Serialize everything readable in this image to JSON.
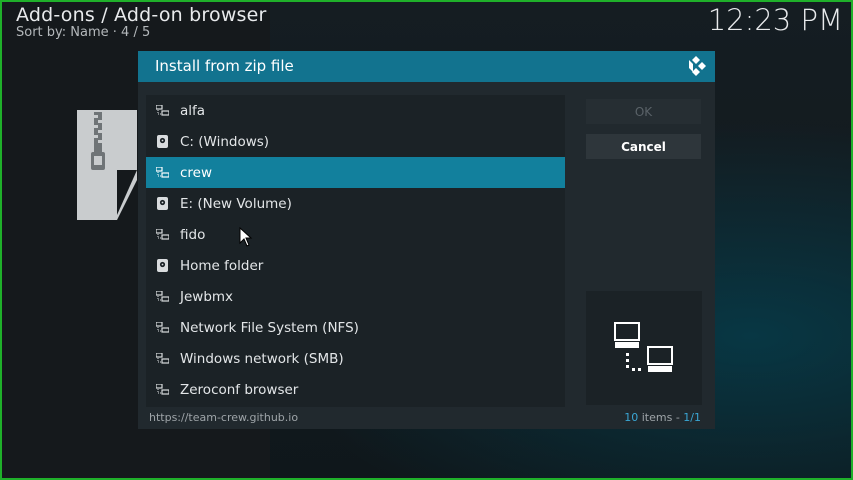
{
  "header": {
    "title": "Add-ons / Add-on browser",
    "subtitle": "Sort by: Name  ·  4 / 5",
    "clock": "12:23 PM"
  },
  "dialog": {
    "title": "Install from zip file",
    "items": [
      {
        "label": "alfa",
        "icon": "network-share-icon"
      },
      {
        "label": "C: (Windows)",
        "icon": "hard-drive-icon"
      },
      {
        "label": "crew",
        "icon": "network-share-icon"
      },
      {
        "label": "E: (New Volume)",
        "icon": "hard-drive-icon"
      },
      {
        "label": "fido",
        "icon": "network-share-icon"
      },
      {
        "label": "Home folder",
        "icon": "hard-drive-icon"
      },
      {
        "label": "Jewbmx",
        "icon": "network-share-icon"
      },
      {
        "label": "Network File System (NFS)",
        "icon": "network-share-icon"
      },
      {
        "label": "Windows network (SMB)",
        "icon": "network-share-icon"
      },
      {
        "label": "Zeroconf browser",
        "icon": "network-share-icon"
      }
    ],
    "selected_index": 2,
    "ok_label": "OK",
    "cancel_label": "Cancel",
    "footer_path": "https://team-crew.github.io",
    "item_count": "10",
    "item_count_suffix": " items - ",
    "page": "1/1"
  },
  "colors": {
    "accent": "#12738f",
    "selected_row": "#12809d",
    "frame": "#1fb02a"
  }
}
